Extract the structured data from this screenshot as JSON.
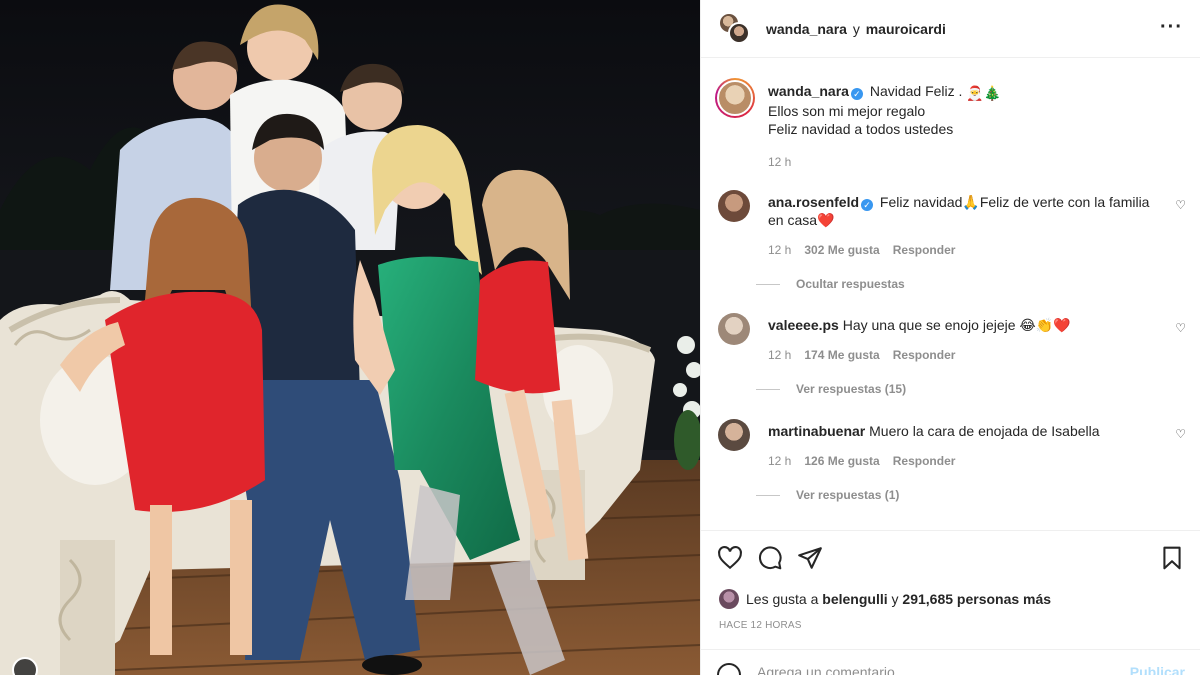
{
  "header": {
    "user1": "wanda_nara",
    "connector": "y",
    "user2": "mauroicardi",
    "more_icon": "more-horizontal-icon"
  },
  "caption": {
    "username": "wanda_nara",
    "line1": "Navidad Feliz .",
    "emoji": "🎅🎄",
    "line2": "Ellos son mi mejor regalo",
    "line3": "Feliz navidad a todos ustedes",
    "time": "12 h"
  },
  "comments": [
    {
      "username": "ana.rosenfeld",
      "verified": true,
      "text": "Feliz navidad🙏Feliz de verte con la familia en casa❤️",
      "time": "12 h",
      "likes": "302 Me gusta",
      "reply": "Responder",
      "thread": "Ocultar respuestas",
      "avatar_color": "#6d4a3a"
    },
    {
      "username": "valeeee.ps",
      "verified": false,
      "text": "Hay una que se enojo jejeje 😂👏❤️",
      "time": "12 h",
      "likes": "174 Me gusta",
      "reply": "Responder",
      "thread": "Ver respuestas (15)",
      "avatar_color": "#c9b8a8"
    },
    {
      "username": "martinabuenar",
      "verified": false,
      "text": "Muero la cara de enojada de Isabella",
      "time": "12 h",
      "likes": "126 Me gusta",
      "reply": "Responder",
      "thread": "Ver respuestas (1)",
      "avatar_color": "#5b4a40"
    }
  ],
  "actions": {
    "icons": [
      "heart-icon",
      "comment-icon",
      "share-icon",
      "bookmark-icon"
    ],
    "likes_prefix": "Les gusta a",
    "liked_by": "belengulli",
    "likes_middle": "y",
    "likes_count": "291,685 personas más",
    "posted": "HACE 12 HORAS"
  },
  "composer": {
    "placeholder": "Agrega un comentario...",
    "publish": "Publicar"
  },
  "colors": {
    "link_blue": "#b2dffc",
    "verified_blue": "#3897f0",
    "muted": "#8e8e8e",
    "dress_green": "#1f9a6a",
    "dress_red": "#e0252c"
  }
}
